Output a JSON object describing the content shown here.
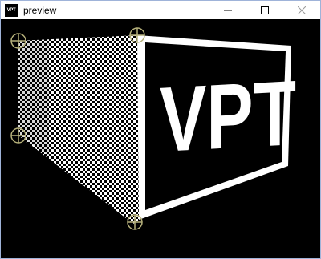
{
  "window": {
    "title": "preview",
    "app_icon_text": "VPT",
    "controls": [
      "minimize-icon",
      "maximize-icon",
      "close-icon"
    ]
  },
  "preview": {
    "logo_text": "VPT",
    "handles": [
      "handle-top-left",
      "handle-top-right",
      "handle-bottom-left",
      "handle-bottom-right"
    ],
    "colors": {
      "background": "#000000",
      "panel": "#ffffff",
      "checker_dark": "#000000",
      "checker_light": "#ffffff",
      "handle": "#b5b07a"
    }
  }
}
